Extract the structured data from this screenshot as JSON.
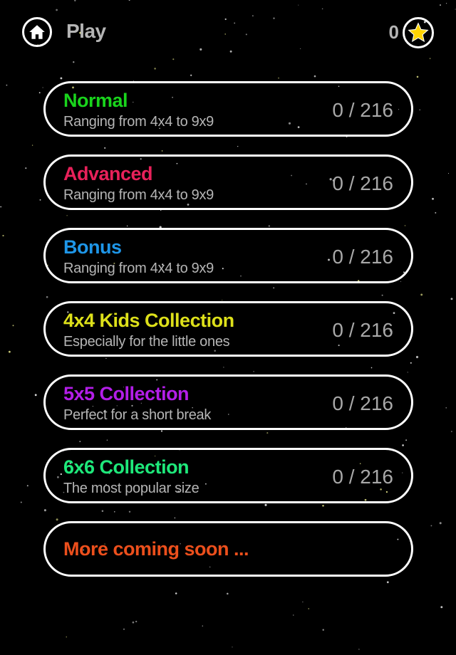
{
  "header": {
    "title": "Play",
    "star_count": "0",
    "home_icon": "home-icon",
    "star_icon": "star-icon"
  },
  "colors": {
    "background": "#000000",
    "border": "#ffffff",
    "subtitle": "#b5b5b5",
    "star": "#ffd400"
  },
  "collections": [
    {
      "name": "Normal",
      "subtitle": "Ranging from 4x4 to 9x9",
      "progress": "0 / 216",
      "color": "#19d41c"
    },
    {
      "name": "Advanced",
      "subtitle": "Ranging from 4x4 to 9x9",
      "progress": "0 / 216",
      "color": "#e8215a"
    },
    {
      "name": "Bonus",
      "subtitle": "Ranging from 4x4 to 9x9",
      "progress": "0 / 216",
      "color": "#1e96e8"
    },
    {
      "name": "4x4 Kids Collection",
      "subtitle": "Especially for the little ones",
      "progress": "0 / 216",
      "color": "#dde01a"
    },
    {
      "name": "5x5 Collection",
      "subtitle": "Perfect for a short break",
      "progress": "0 / 216",
      "color": "#b31ee8"
    },
    {
      "name": "6x6 Collection",
      "subtitle": "The most popular size",
      "progress": "0 / 216",
      "color": "#1ee87a"
    }
  ],
  "more": {
    "label": "More coming soon ...",
    "color": "#ec4f1c"
  }
}
